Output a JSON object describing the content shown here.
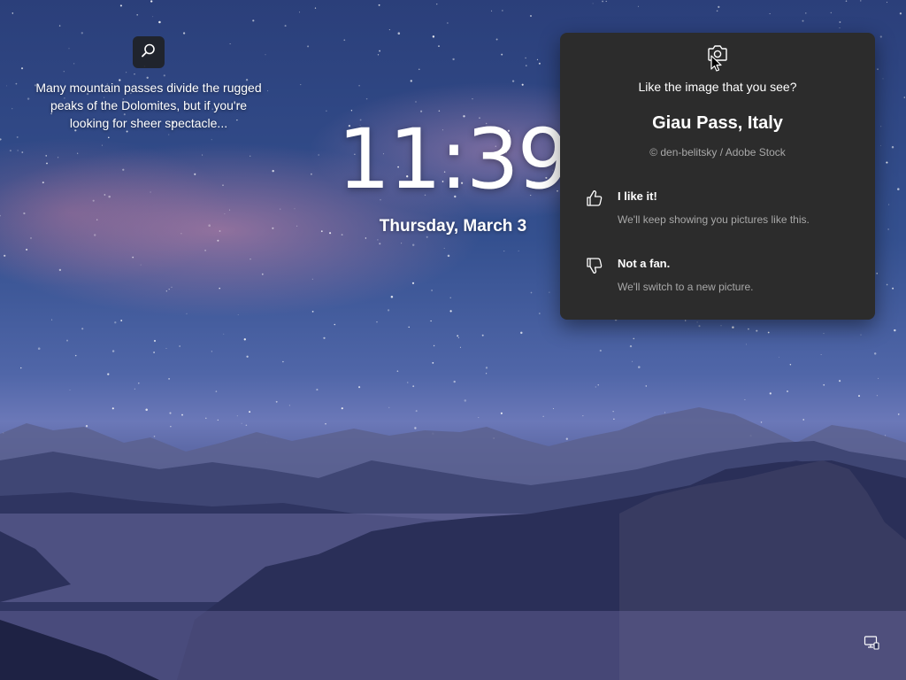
{
  "spotlight": {
    "search_icon": "search-icon",
    "description": "Many mountain passes divide the rugged peaks of the Dolomites, but if you're looking for sheer spectacle..."
  },
  "lockscreen": {
    "time": "11:39",
    "date": "Thursday, March 3"
  },
  "panel": {
    "camera_icon": "camera-icon",
    "question": "Like the image that you see?",
    "location": "Giau Pass, Italy",
    "credit": "© den-belitsky / Adobe Stock",
    "like": {
      "icon": "thumbs-up-icon",
      "title": "I like it!",
      "subtitle": "We'll keep showing you pictures like this."
    },
    "dislike": {
      "icon": "thumbs-down-icon",
      "title": "Not a fan.",
      "subtitle": "We'll switch to a new picture."
    }
  },
  "tray": {
    "network_icon": "network-icon"
  },
  "colors": {
    "panel_bg": "#2c2c2c",
    "secondary_text": "#a8a8a8",
    "primary_text": "#ffffff"
  }
}
